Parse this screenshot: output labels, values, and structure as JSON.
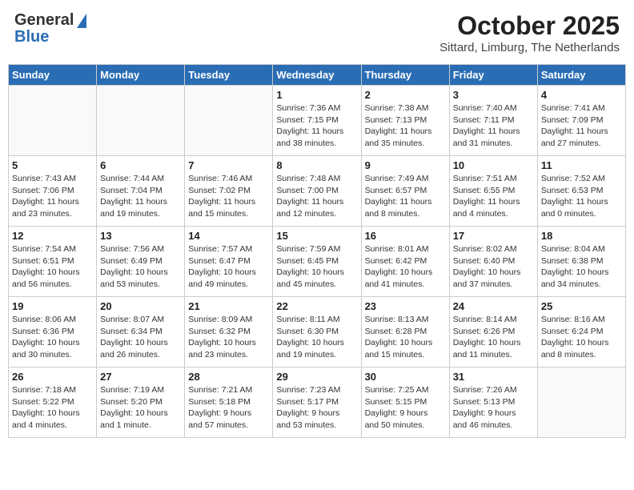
{
  "header": {
    "logo_line1": "General",
    "logo_line2": "Blue",
    "month": "October 2025",
    "location": "Sittard, Limburg, The Netherlands"
  },
  "weekdays": [
    "Sunday",
    "Monday",
    "Tuesday",
    "Wednesday",
    "Thursday",
    "Friday",
    "Saturday"
  ],
  "weeks": [
    [
      {
        "day": "",
        "info": ""
      },
      {
        "day": "",
        "info": ""
      },
      {
        "day": "",
        "info": ""
      },
      {
        "day": "1",
        "info": "Sunrise: 7:36 AM\nSunset: 7:15 PM\nDaylight: 11 hours\nand 38 minutes."
      },
      {
        "day": "2",
        "info": "Sunrise: 7:38 AM\nSunset: 7:13 PM\nDaylight: 11 hours\nand 35 minutes."
      },
      {
        "day": "3",
        "info": "Sunrise: 7:40 AM\nSunset: 7:11 PM\nDaylight: 11 hours\nand 31 minutes."
      },
      {
        "day": "4",
        "info": "Sunrise: 7:41 AM\nSunset: 7:09 PM\nDaylight: 11 hours\nand 27 minutes."
      }
    ],
    [
      {
        "day": "5",
        "info": "Sunrise: 7:43 AM\nSunset: 7:06 PM\nDaylight: 11 hours\nand 23 minutes."
      },
      {
        "day": "6",
        "info": "Sunrise: 7:44 AM\nSunset: 7:04 PM\nDaylight: 11 hours\nand 19 minutes."
      },
      {
        "day": "7",
        "info": "Sunrise: 7:46 AM\nSunset: 7:02 PM\nDaylight: 11 hours\nand 15 minutes."
      },
      {
        "day": "8",
        "info": "Sunrise: 7:48 AM\nSunset: 7:00 PM\nDaylight: 11 hours\nand 12 minutes."
      },
      {
        "day": "9",
        "info": "Sunrise: 7:49 AM\nSunset: 6:57 PM\nDaylight: 11 hours\nand 8 minutes."
      },
      {
        "day": "10",
        "info": "Sunrise: 7:51 AM\nSunset: 6:55 PM\nDaylight: 11 hours\nand 4 minutes."
      },
      {
        "day": "11",
        "info": "Sunrise: 7:52 AM\nSunset: 6:53 PM\nDaylight: 11 hours\nand 0 minutes."
      }
    ],
    [
      {
        "day": "12",
        "info": "Sunrise: 7:54 AM\nSunset: 6:51 PM\nDaylight: 10 hours\nand 56 minutes."
      },
      {
        "day": "13",
        "info": "Sunrise: 7:56 AM\nSunset: 6:49 PM\nDaylight: 10 hours\nand 53 minutes."
      },
      {
        "day": "14",
        "info": "Sunrise: 7:57 AM\nSunset: 6:47 PM\nDaylight: 10 hours\nand 49 minutes."
      },
      {
        "day": "15",
        "info": "Sunrise: 7:59 AM\nSunset: 6:45 PM\nDaylight: 10 hours\nand 45 minutes."
      },
      {
        "day": "16",
        "info": "Sunrise: 8:01 AM\nSunset: 6:42 PM\nDaylight: 10 hours\nand 41 minutes."
      },
      {
        "day": "17",
        "info": "Sunrise: 8:02 AM\nSunset: 6:40 PM\nDaylight: 10 hours\nand 37 minutes."
      },
      {
        "day": "18",
        "info": "Sunrise: 8:04 AM\nSunset: 6:38 PM\nDaylight: 10 hours\nand 34 minutes."
      }
    ],
    [
      {
        "day": "19",
        "info": "Sunrise: 8:06 AM\nSunset: 6:36 PM\nDaylight: 10 hours\nand 30 minutes."
      },
      {
        "day": "20",
        "info": "Sunrise: 8:07 AM\nSunset: 6:34 PM\nDaylight: 10 hours\nand 26 minutes."
      },
      {
        "day": "21",
        "info": "Sunrise: 8:09 AM\nSunset: 6:32 PM\nDaylight: 10 hours\nand 23 minutes."
      },
      {
        "day": "22",
        "info": "Sunrise: 8:11 AM\nSunset: 6:30 PM\nDaylight: 10 hours\nand 19 minutes."
      },
      {
        "day": "23",
        "info": "Sunrise: 8:13 AM\nSunset: 6:28 PM\nDaylight: 10 hours\nand 15 minutes."
      },
      {
        "day": "24",
        "info": "Sunrise: 8:14 AM\nSunset: 6:26 PM\nDaylight: 10 hours\nand 11 minutes."
      },
      {
        "day": "25",
        "info": "Sunrise: 8:16 AM\nSunset: 6:24 PM\nDaylight: 10 hours\nand 8 minutes."
      }
    ],
    [
      {
        "day": "26",
        "info": "Sunrise: 7:18 AM\nSunset: 5:22 PM\nDaylight: 10 hours\nand 4 minutes."
      },
      {
        "day": "27",
        "info": "Sunrise: 7:19 AM\nSunset: 5:20 PM\nDaylight: 10 hours\nand 1 minute."
      },
      {
        "day": "28",
        "info": "Sunrise: 7:21 AM\nSunset: 5:18 PM\nDaylight: 9 hours\nand 57 minutes."
      },
      {
        "day": "29",
        "info": "Sunrise: 7:23 AM\nSunset: 5:17 PM\nDaylight: 9 hours\nand 53 minutes."
      },
      {
        "day": "30",
        "info": "Sunrise: 7:25 AM\nSunset: 5:15 PM\nDaylight: 9 hours\nand 50 minutes."
      },
      {
        "day": "31",
        "info": "Sunrise: 7:26 AM\nSunset: 5:13 PM\nDaylight: 9 hours\nand 46 minutes."
      },
      {
        "day": "",
        "info": ""
      }
    ]
  ]
}
